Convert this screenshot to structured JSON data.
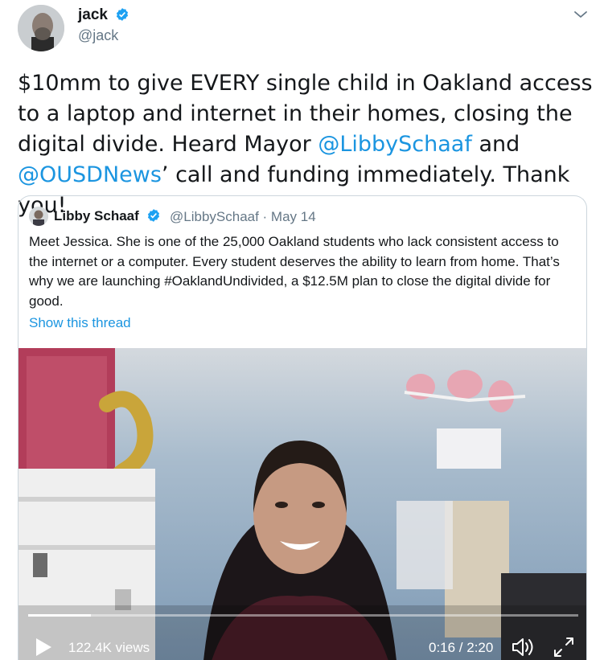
{
  "author": {
    "name": "jack",
    "handle": "@jack",
    "verified": true
  },
  "tweet": {
    "segments": [
      {
        "text": "$10mm to give EVERY single child in Oakland access to a laptop and internet in their homes, closing the digital divide. Heard Mayor ",
        "link": false
      },
      {
        "text": "@LibbySchaaf",
        "link": true
      },
      {
        "text": " and ",
        "link": false
      },
      {
        "text": "@OUSDNews",
        "link": true
      },
      {
        "text": "’ call and funding immediately. Thank you!",
        "link": false
      }
    ]
  },
  "quote": {
    "name": "Libby Schaaf",
    "verified": true,
    "meta": "@LibbySchaaf · May 14",
    "text": "Meet Jessica. She is one of the 25,000 Oakland students who lack consistent access to the internet or a computer. Every student deserves the ability to learn from home. That’s why we are launching #OaklandUndivided, a $12.5M plan to close the digital divide for good.",
    "show_thread": "Show this thread",
    "video": {
      "views": "122.4K views",
      "time": "0:16 / 2:20",
      "progress": 0.114
    }
  },
  "colors": {
    "link": "#1b95e0",
    "verified": "#1da1f2",
    "secondary_text": "#657786",
    "border": "#ccd6dd"
  },
  "icons": [
    "verified-icon",
    "chevron-down-icon",
    "play-icon",
    "volume-icon",
    "fullscreen-icon"
  ]
}
